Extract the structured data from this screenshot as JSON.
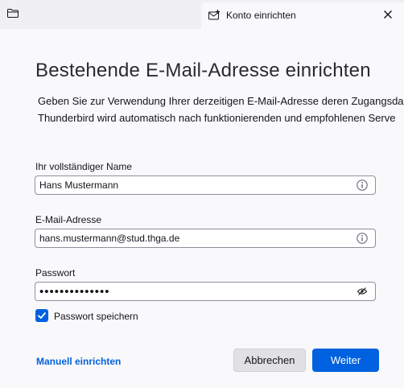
{
  "tabbar": {
    "folder_tab_icon": "folder-icon",
    "active_tab": {
      "title": "Konto einrichten",
      "icon": "envelope-plus-icon",
      "close_icon": "close-icon"
    }
  },
  "page": {
    "title": "Bestehende E-Mail-Adresse einrichten",
    "intro_lines": [
      "Geben Sie zur Verwendung Ihrer derzeitigen E-Mail-Adresse deren Zugangsda",
      "Thunderbird wird automatisch nach funktionierenden und empfohlenen Serve"
    ]
  },
  "form": {
    "name": {
      "label": "Ihr vollständiger Name",
      "value": "Hans Mustermann",
      "icon": "info-icon"
    },
    "email": {
      "label": "E-Mail-Adresse",
      "value": "hans.mustermann@stud.thga.de",
      "icon": "info-icon"
    },
    "password": {
      "label": "Passwort",
      "value": "••••••••••••••",
      "icon": "eye-slash-icon"
    },
    "remember": {
      "label": "Passwort speichern",
      "checked": true
    }
  },
  "actions": {
    "manual_setup": "Manuell einrichten",
    "cancel": "Abbrechen",
    "next": "Weiter"
  },
  "colors": {
    "accent": "#0061e0",
    "background": "#f9f9fb",
    "tabbar": "#f0f0f4"
  }
}
